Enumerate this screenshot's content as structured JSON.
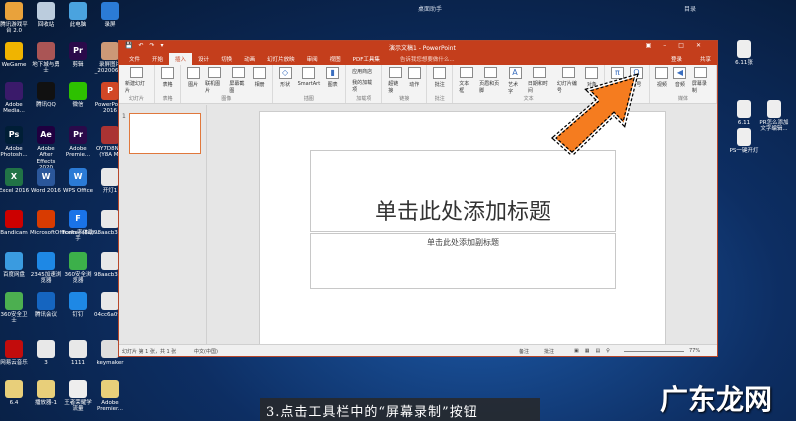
{
  "topbar": {
    "title": "桌面助手",
    "right": "目录"
  },
  "desktop_icons": [
    {
      "label": "腾讯游戏平台 2.0",
      "color": "#e9a23b"
    },
    {
      "label": "回收站",
      "color": "#bcd"
    },
    {
      "label": "此电脑",
      "color": "#4aa3df"
    },
    {
      "label": "录屏",
      "color": "#2b7bd6"
    },
    {
      "label": "WeGame",
      "color": "#f0b400"
    },
    {
      "label": "地下城与勇士",
      "color": "#a55"
    },
    {
      "label": "剪辑",
      "color": "#2a0a4a",
      "text": "Pr"
    },
    {
      "label": "录屏图片_20200617",
      "color": "#c97"
    },
    {
      "label": "Adobe Media...",
      "color": "#3a1a6a"
    },
    {
      "label": "腾讯QQ",
      "color": "#111"
    },
    {
      "label": "微信",
      "color": "#2dc100"
    },
    {
      "label": "PowerPoint 2016",
      "color": "#d24726",
      "text": "P"
    },
    {
      "label": "Adobe Photosh...",
      "color": "#001e36",
      "text": "Ps"
    },
    {
      "label": "Adobe After Effects 2020",
      "color": "#1f0040",
      "text": "Ae"
    },
    {
      "label": "Adobe Premie...",
      "color": "#2a0a4a",
      "text": "Pr"
    },
    {
      "label": "OY7D8N...(Y8A M)",
      "color": "#a33"
    },
    {
      "label": "Excel 2016",
      "color": "#217346",
      "text": "X"
    },
    {
      "label": "Word 2016",
      "color": "#2b579a",
      "text": "W"
    },
    {
      "label": "WPS Office",
      "color": "#2b7bd6",
      "text": "W"
    },
    {
      "label": "开灯1",
      "color": "#e8e8e8"
    },
    {
      "label": "Bandicam",
      "color": "#c00"
    },
    {
      "label": "MicrosoftOfficeInstallati...",
      "color": "#d83b01"
    },
    {
      "label": "Fonts字体助手",
      "color": "#1a73e8",
      "text": "F"
    },
    {
      "label": "98aacb3257d6e2e",
      "color": "#e8e8e8"
    },
    {
      "label": "百度网盘",
      "color": "#3a9be0"
    },
    {
      "label": "2345加速浏览器",
      "color": "#1e88e5"
    },
    {
      "label": "360安全浏览器",
      "color": "#3cb04a"
    },
    {
      "label": "98aacb3257d6e2e",
      "color": "#e8e8e8"
    },
    {
      "label": "360安全卫士",
      "color": "#4caf50"
    },
    {
      "label": "腾讯会议",
      "color": "#1565c0"
    },
    {
      "label": "钉钉",
      "color": "#1e88e5"
    },
    {
      "label": "04cc6a09eefc4170",
      "color": "#e8e8e8"
    },
    {
      "label": "网易云音乐",
      "color": "#c20c0c"
    },
    {
      "label": "3",
      "color": "#e8e8e8"
    },
    {
      "label": "1111",
      "color": "#e8e8e8"
    },
    {
      "label": "keymaker",
      "color": "#ddd"
    },
    {
      "label": "6.4",
      "color": "#e8cf7a"
    },
    {
      "label": "播放器-1",
      "color": "#e8cf7a"
    },
    {
      "label": "王者荣耀学流量",
      "color": "#eee"
    },
    {
      "label": "Adobe Premier...",
      "color": "#e8cf7a"
    }
  ],
  "right_icons": [
    {
      "label": "6.11张"
    },
    {
      "label": "6.11"
    },
    {
      "label": "PR怎么添加文字编辑..."
    },
    {
      "label": "PS一键开灯"
    }
  ],
  "window": {
    "title": "演示文稿1 - PowerPoint",
    "login": "登录",
    "share": "共享",
    "search": "告诉我您想要做什么...",
    "tabs": [
      "文件",
      "开始",
      "插入",
      "设计",
      "切换",
      "动画",
      "幻灯片放映",
      "审阅",
      "视图",
      "PDF工具集"
    ],
    "active_tab": "插入",
    "groups": [
      {
        "label": "幻灯片",
        "buttons": [
          "新建幻灯片"
        ]
      },
      {
        "label": "表格",
        "buttons": [
          "表格"
        ]
      },
      {
        "label": "图像",
        "buttons": [
          "图片",
          "联机图片",
          "屏幕截图",
          "相册"
        ]
      },
      {
        "label": "插图",
        "buttons": [
          "形状",
          "SmartArt",
          "图表"
        ]
      },
      {
        "label": "加载项",
        "buttons": [
          "应用商店",
          "我的加载项"
        ]
      },
      {
        "label": "链接",
        "buttons": [
          "超链接",
          "动作"
        ]
      },
      {
        "label": "批注",
        "buttons": [
          "批注"
        ]
      },
      {
        "label": "文本",
        "buttons": [
          "文本框",
          "页眉和页脚",
          "艺术字",
          "日期和时间",
          "幻灯片编号",
          "对象"
        ]
      },
      {
        "label": "符号",
        "buttons": [
          "公式",
          "符号"
        ]
      },
      {
        "label": "媒体",
        "buttons": [
          "视频",
          "音频",
          "屏幕录制"
        ]
      }
    ],
    "slide_number": "1",
    "slide_title": "单击此处添加标题",
    "slide_subtitle": "单击此处添加副标题",
    "status_left": "幻灯片 第 1 张，共 1 张",
    "status_lang": "中文(中国)",
    "status_notes": "备注",
    "status_comments": "批注",
    "zoom": "77%"
  },
  "caption": "3.点击工具栏中的“屏幕录制”按钮",
  "watermark": "广东龙网",
  "colors": {
    "accent": "#c43e1c",
    "arrow": "#f57c1f"
  }
}
